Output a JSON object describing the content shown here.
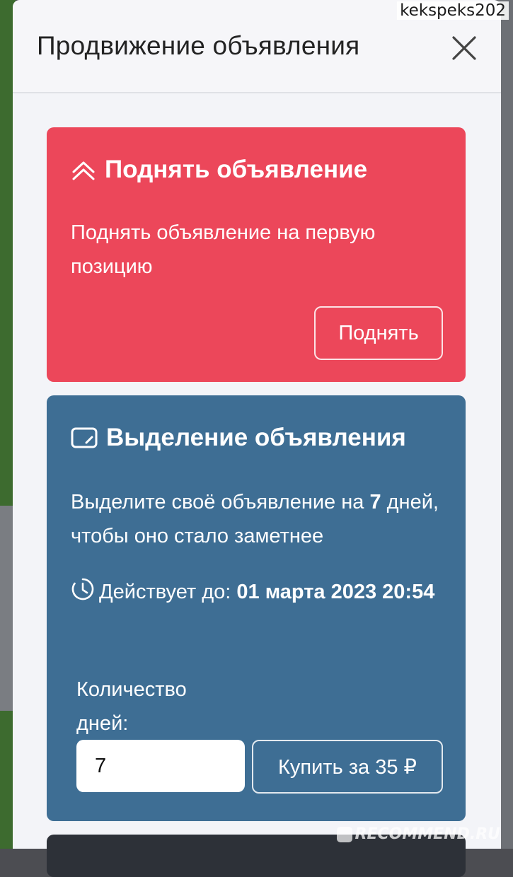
{
  "watermark": {
    "username": "kekspeks202",
    "site": "RECOMMEND.RU"
  },
  "modal": {
    "title": "Продвижение объявления",
    "close_icon": "close-icon"
  },
  "raise_card": {
    "icon": "double-chevron-up-icon",
    "title": "Поднять объявление",
    "description": "Поднять объявление на первую позицию",
    "button_label": "Поднять",
    "color": "#ec475a"
  },
  "highlight_card": {
    "icon": "highlight-card-icon",
    "title": "Выделение объявления",
    "description_prefix": "Выделите своё объявление на ",
    "description_days": "7",
    "description_suffix": " дней, чтобы оно стало заметнее",
    "valid_label": "Действует до: ",
    "valid_until": "01 марта 2023 20:54",
    "quantity_label": "Количество дней:",
    "quantity_value": "7",
    "buy_button_label": "Купить за 35 ₽",
    "color": "#3e6e94"
  }
}
